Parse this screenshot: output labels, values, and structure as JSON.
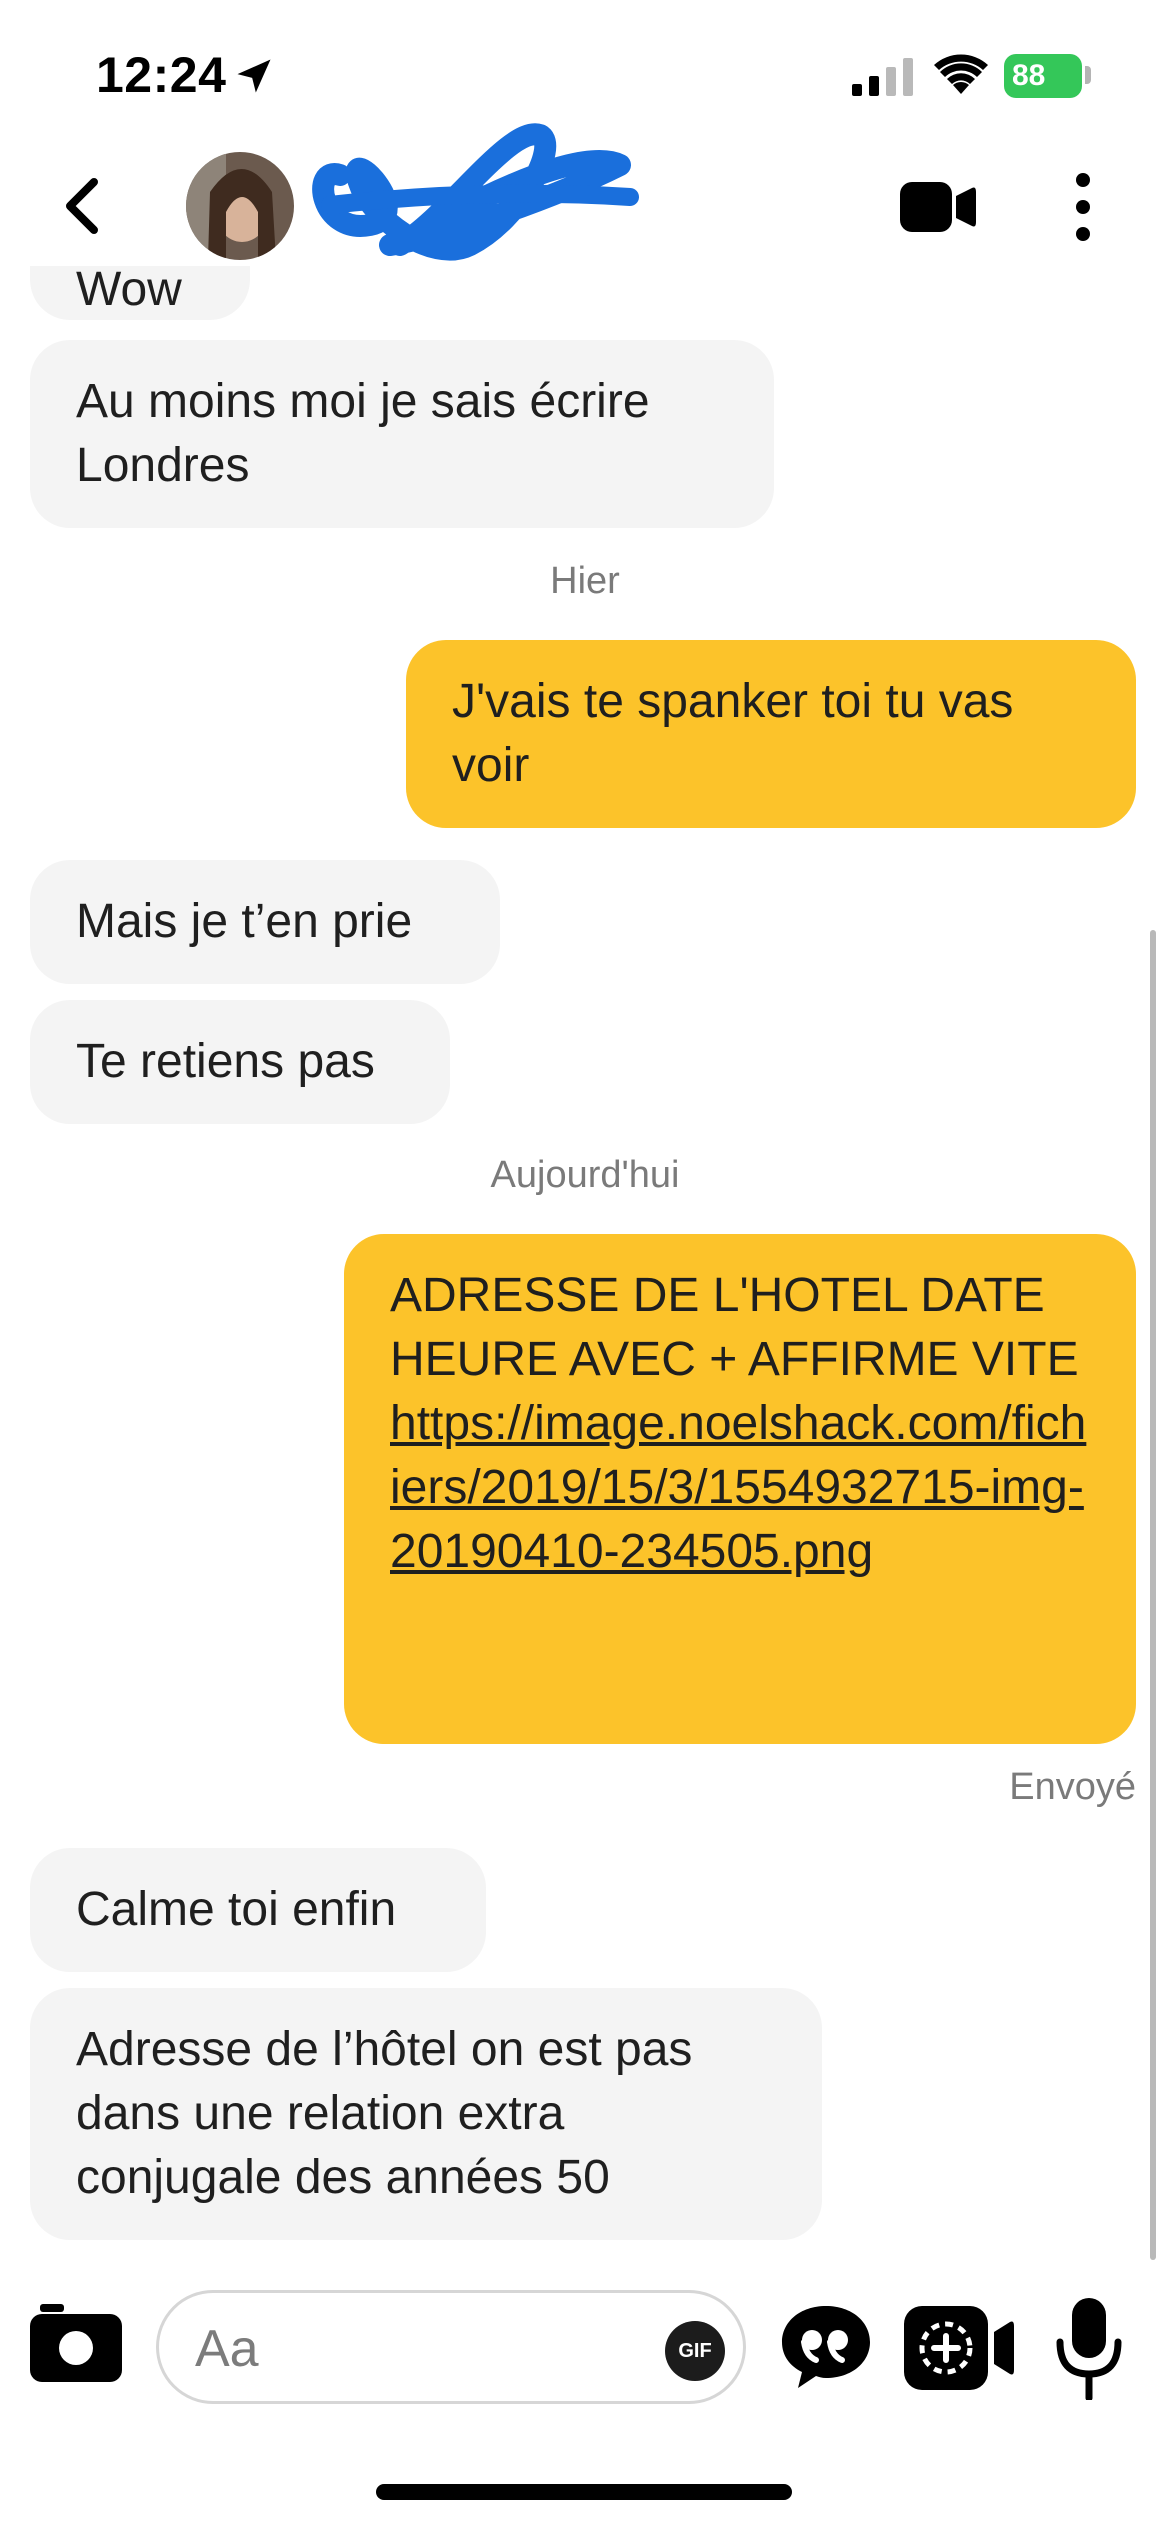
{
  "status_bar": {
    "time": "12:24",
    "battery": "88"
  },
  "header": {
    "back_icon": "chevron-left-icon",
    "video_icon": "video-call-icon",
    "more_icon": "more-vertical-icon"
  },
  "messages": [
    {
      "side": "in",
      "text": "Wow"
    },
    {
      "side": "in",
      "text": "Au moins moi je sais écrire Londres"
    },
    {
      "side": "day",
      "text": "Hier"
    },
    {
      "side": "out",
      "text": "J'vais te spanker toi tu vas voir"
    },
    {
      "side": "in",
      "text": "Mais je t’en prie"
    },
    {
      "side": "in",
      "text": "Te retiens pas"
    },
    {
      "side": "day",
      "text": "Aujourd'hui"
    },
    {
      "side": "out",
      "text_prefix": "ADRESSE DE L'HOTEL DATE HEURE AVEC + AFFIRME VITE",
      "link": "https://image.noelshack.com/fichiers/2019/15/3/1554932715-img-20190410-234505.png"
    },
    {
      "side": "status",
      "text": "Envoyé"
    },
    {
      "side": "in",
      "text": "Calme toi enfin"
    },
    {
      "side": "in",
      "text": "Adresse de l’hôtel on est pas dans une relation extra conjugale des années 50"
    }
  ],
  "composer": {
    "placeholder": "Aa",
    "gif_label": "GIF",
    "icons": [
      "camera-icon",
      "quote-icon",
      "camera-plus-icon",
      "microphone-icon"
    ]
  },
  "colors": {
    "outgoing_bubble": "#fcc32a",
    "incoming_bubble": "#f4f4f4",
    "battery": "#34c759"
  }
}
